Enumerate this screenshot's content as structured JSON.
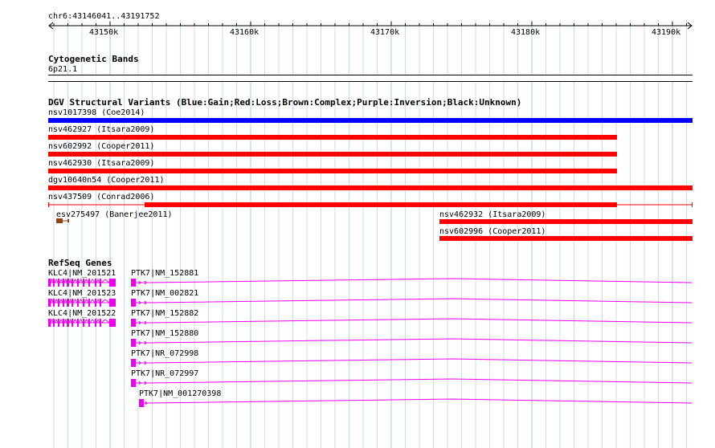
{
  "ruler": {
    "position_label": "chr6:43146041..43191752",
    "ticks": [
      "43150k",
      "43160k",
      "43170k",
      "43180k",
      "43190k"
    ]
  },
  "cytoband": {
    "title": "Cytogenetic Bands",
    "band": "6p21.1"
  },
  "dgv": {
    "title": "DGV Structural Variants (Blue:Gain;Red:Loss;Brown:Complex;Purple:Inversion;Black:Unknown)",
    "colors": {
      "gain": "#0000ff",
      "loss": "#ff0000",
      "complex": "#8b4513"
    },
    "features": [
      {
        "label": "nsv1017398 (Coe2014)",
        "type": "gain"
      },
      {
        "label": "nsv462927 (Itsara2009)",
        "type": "loss"
      },
      {
        "label": "nsv602992 (Cooper2011)",
        "type": "loss"
      },
      {
        "label": "nsv462930 (Itsara2009)",
        "type": "loss"
      },
      {
        "label": "dgv10640n54 (Cooper2011)",
        "type": "loss"
      },
      {
        "label": "nsv437509 (Conrad2006)",
        "type": "loss"
      },
      {
        "label": "esv275497 (Banerjee2011)",
        "type": "complex"
      },
      {
        "label": "nsv462932 (Itsara2009)",
        "type": "loss"
      },
      {
        "label": "nsv602996 (Cooper2011)",
        "type": "loss"
      }
    ]
  },
  "refseq": {
    "title": "RefSeq Genes",
    "color": "#ee00ee",
    "klc4": [
      {
        "label": "KLC4|NM_201521"
      },
      {
        "label": "KLC4|NM_201523"
      },
      {
        "label": "KLC4|NM_201522"
      }
    ],
    "ptk7": [
      {
        "label": "PTK7|NM_152881"
      },
      {
        "label": "PTK7|NM_002821"
      },
      {
        "label": "PTK7|NM_152882"
      },
      {
        "label": "PTK7|NM_152880"
      },
      {
        "label": "PTK7|NR_072998"
      },
      {
        "label": "PTK7|NR_072997"
      },
      {
        "label": "PTK7|NM_001270398"
      }
    ]
  }
}
